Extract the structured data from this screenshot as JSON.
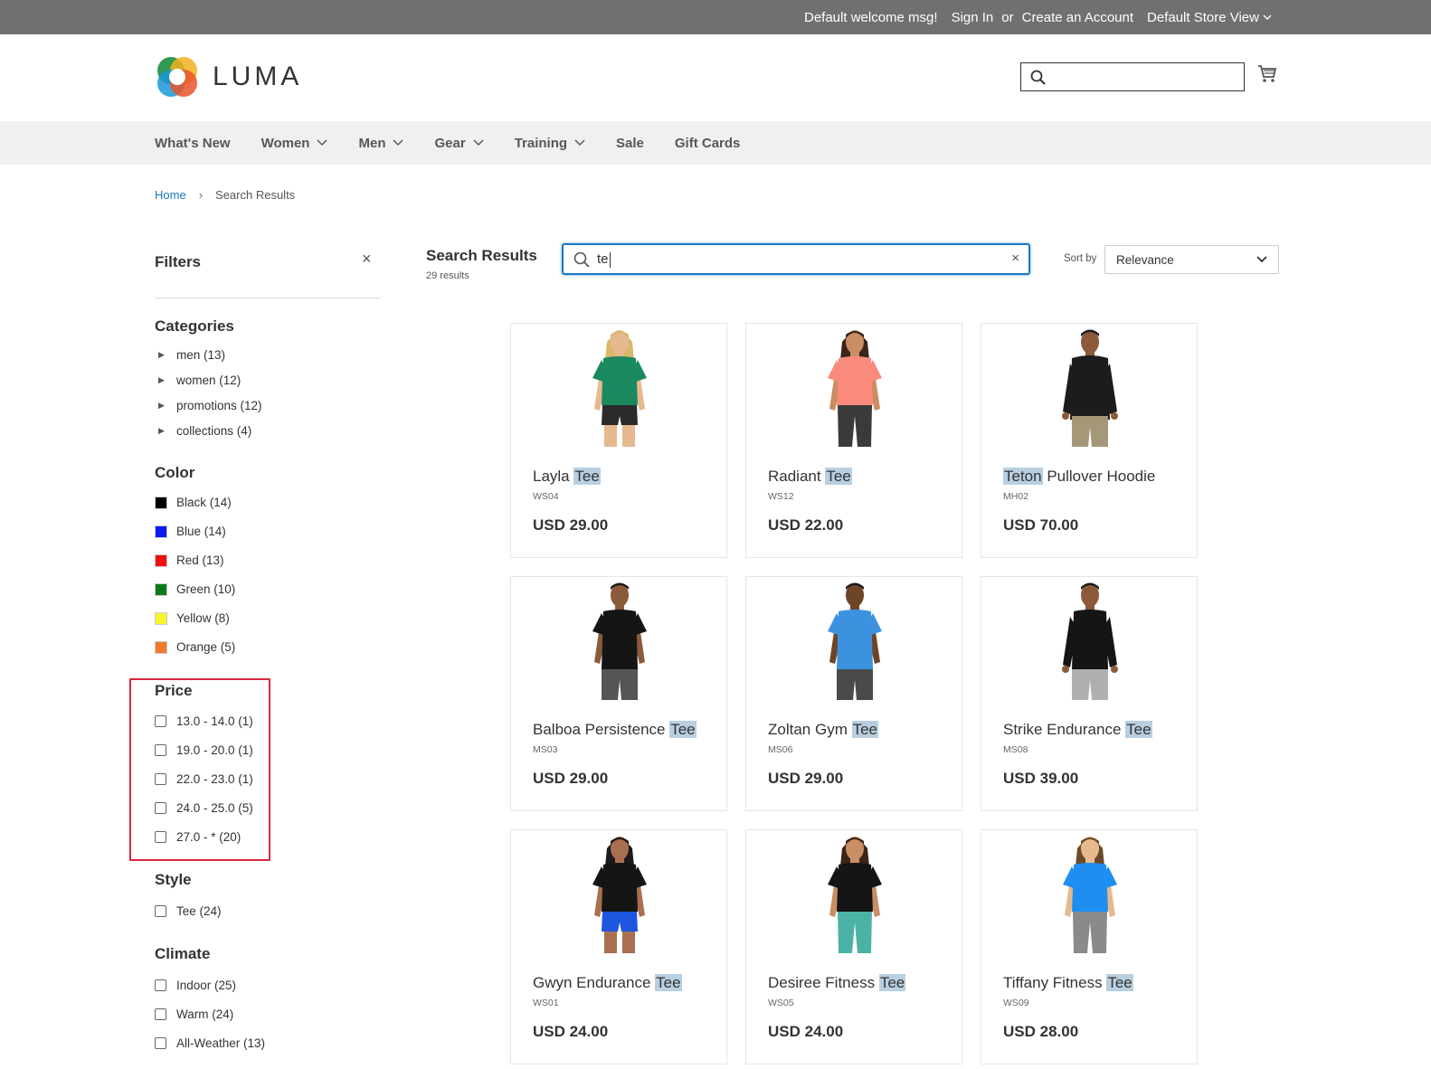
{
  "topbar": {
    "welcome": "Default welcome msg!",
    "sign_in": "Sign In",
    "or": "or",
    "create_account": "Create an Account",
    "store_view": "Default Store View"
  },
  "header": {
    "logo_text": "LUMA",
    "search_placeholder": ""
  },
  "nav": {
    "items": [
      {
        "label": "What's New",
        "dropdown": false
      },
      {
        "label": "Women",
        "dropdown": true
      },
      {
        "label": "Men",
        "dropdown": true
      },
      {
        "label": "Gear",
        "dropdown": true
      },
      {
        "label": "Training",
        "dropdown": true
      },
      {
        "label": "Sale",
        "dropdown": false
      },
      {
        "label": "Gift Cards",
        "dropdown": false
      }
    ]
  },
  "breadcrumb": {
    "home": "Home",
    "separator": "›",
    "current": "Search Results"
  },
  "filters": {
    "title": "Filters",
    "close": "×",
    "categories": {
      "title": "Categories",
      "items": [
        "men (13)",
        "women (12)",
        "promotions (12)",
        "collections (4)"
      ]
    },
    "color": {
      "title": "Color",
      "items": [
        {
          "label": "Black (14)",
          "color": "#000000"
        },
        {
          "label": "Blue (14)",
          "color": "#0a1cf0"
        },
        {
          "label": "Red (13)",
          "color": "#f01010"
        },
        {
          "label": "Green (10)",
          "color": "#0c7a1c"
        },
        {
          "label": "Yellow (8)",
          "color": "#f5f530"
        },
        {
          "label": "Orange (5)",
          "color": "#f07a2a"
        }
      ]
    },
    "price": {
      "title": "Price",
      "items": [
        "13.0 - 14.0 (1)",
        "19.0 - 20.0 (1)",
        "22.0 - 23.0 (1)",
        "24.0 - 25.0 (5)",
        "27.0 - * (20)"
      ]
    },
    "style": {
      "title": "Style",
      "items": [
        "Tee (24)"
      ]
    },
    "climate": {
      "title": "Climate",
      "items": [
        "Indoor (25)",
        "Warm (24)",
        "All-Weather (13)"
      ]
    }
  },
  "results": {
    "title": "Search Results",
    "count": "29 results",
    "query": "te",
    "clear": "×",
    "sort_label": "Sort by",
    "sort_value": "Relevance"
  },
  "products": [
    {
      "pre": "Layla ",
      "hl": "Tee",
      "post": "",
      "sku": "WS04",
      "price": "USD 29.00",
      "shirt": "#1a8a5e",
      "bottom": "#2b2b2b",
      "skin": "#e7b98f",
      "hair": "#d9b86a",
      "fig": "female-short"
    },
    {
      "pre": "Radiant ",
      "hl": "Tee",
      "post": "",
      "sku": "WS12",
      "price": "USD 22.00",
      "shirt": "#f98a7c",
      "bottom": "#3a3a3a",
      "skin": "#c98e64",
      "hair": "#3b2418",
      "fig": "female-pants"
    },
    {
      "pre": "",
      "hl": "Teton",
      "post": " Pullover Hoodie",
      "sku": "MH02",
      "price": "USD 70.00",
      "shirt": "#1c1c1c",
      "bottom": "#a59878",
      "skin": "#8a5a3a",
      "hair": "#1a1a1a",
      "fig": "male-long"
    },
    {
      "pre": "Balboa Persistence ",
      "hl": "Tee",
      "post": "",
      "sku": "MS03",
      "price": "USD 29.00",
      "shirt": "#151515",
      "bottom": "#555555",
      "skin": "#8a5a3a",
      "hair": "#1a1a1a",
      "fig": "male-short"
    },
    {
      "pre": "Zoltan Gym ",
      "hl": "Tee",
      "post": "",
      "sku": "MS06",
      "price": "USD 29.00",
      "shirt": "#3d92e0",
      "bottom": "#4a4a4a",
      "skin": "#6e4428",
      "hair": "#1a1a1a",
      "fig": "male-short"
    },
    {
      "pre": "Strike Endurance ",
      "hl": "Tee",
      "post": "",
      "sku": "MS08",
      "price": "USD 39.00",
      "shirt": "#151515",
      "bottom": "#b0b0b0",
      "skin": "#8a5a3a",
      "hair": "#1a1a1a",
      "fig": "male-long"
    },
    {
      "pre": "Gwyn Endurance ",
      "hl": "Tee",
      "post": "",
      "sku": "WS01",
      "price": "USD 24.00",
      "shirt": "#151515",
      "bottom": "#1e56e0",
      "skin": "#a87050",
      "hair": "#1a1a1a",
      "fig": "female-short"
    },
    {
      "pre": "Desiree Fitness ",
      "hl": "Tee",
      "post": "",
      "sku": "WS05",
      "price": "USD 24.00",
      "shirt": "#151515",
      "bottom": "#4bb3a3",
      "skin": "#c98e64",
      "hair": "#3b2418",
      "fig": "female-pants"
    },
    {
      "pre": "Tiffany Fitness ",
      "hl": "Tee",
      "post": "",
      "sku": "WS09",
      "price": "USD 28.00",
      "shirt": "#1e8ff0",
      "bottom": "#8a8a8a",
      "skin": "#e7b98f",
      "hair": "#6a4a2a",
      "fig": "female-pants"
    }
  ]
}
